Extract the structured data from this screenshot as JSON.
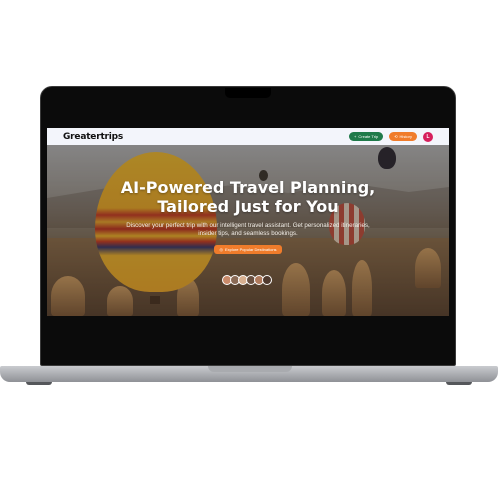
{
  "navbar": {
    "logo": "Greatertrips",
    "create_trip_label": "Create Trip",
    "history_label": "History",
    "avatar_initial": "L"
  },
  "hero": {
    "headline_line1": "AI-Powered Travel Planning,",
    "headline_line2": "Tailored Just for You",
    "subtitle": "Discover your perfect trip with our intelligent travel assistant. Get personalized itineraries, insider tips, and seamless bookings.",
    "cta_label": "Explore Popular Destinations"
  },
  "colors": {
    "accent_orange": "#f07c2b",
    "create_green": "#1f7a4a",
    "avatar_pink": "#d61f5c",
    "navbar_bg": "#f3f5fb"
  },
  "icons": [
    "plus-icon",
    "history-icon",
    "compass-icon"
  ]
}
